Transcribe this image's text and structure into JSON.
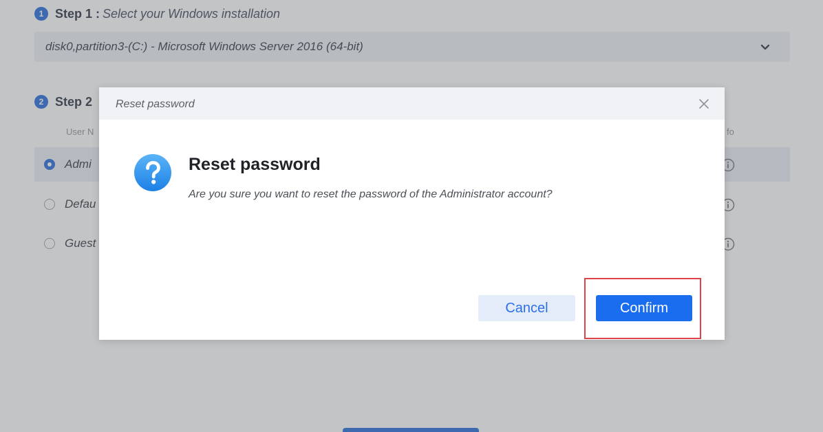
{
  "step1": {
    "number": "1",
    "label": "Step 1 :",
    "description": "Select your Windows installation",
    "selected_value": "disk0,partition3-(C:) - Microsoft Windows Server 2016 (64-bit)"
  },
  "step2": {
    "number": "2",
    "label": "Step 2",
    "col_user_partial": "User N",
    "col_info_partial": "fo",
    "users": [
      {
        "name_partial": "Admi",
        "selected": true
      },
      {
        "name_partial": "Defau",
        "selected": false
      },
      {
        "name_partial": "Guest",
        "selected": false
      }
    ]
  },
  "dialog": {
    "window_title": "Reset password",
    "heading": "Reset password",
    "message": "Are you sure you want to reset the password of the Administrator account?",
    "cancel_label": "Cancel",
    "confirm_label": "Confirm",
    "icon": "question-icon"
  },
  "colors": {
    "accent": "#1a6dee",
    "highlight": "#e0424c",
    "cancel_bg": "#e4ecfa"
  }
}
